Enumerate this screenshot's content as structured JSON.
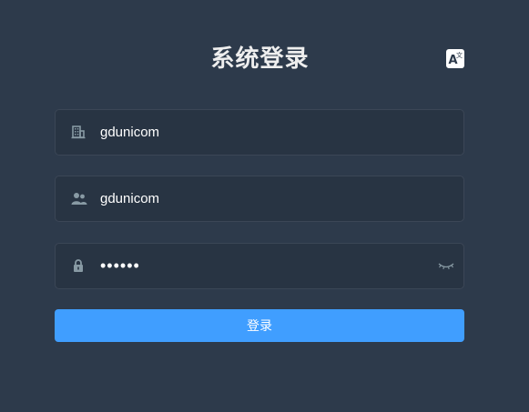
{
  "title": "系统登录",
  "lang_switch": {
    "icon": "translate-icon",
    "label": "A文"
  },
  "fields": {
    "tenant": {
      "icon": "building-icon",
      "value": "gdunicom"
    },
    "username": {
      "icon": "user-group-icon",
      "value": "gdunicom"
    },
    "password": {
      "icon": "lock-icon",
      "value": "123456",
      "toggle_icon": "eye-closed-icon"
    }
  },
  "login_button": {
    "label": "登录"
  },
  "colors": {
    "background": "#2d3a4b",
    "input_background": "#283443",
    "input_border": "#3b4656",
    "primary": "#409eff",
    "title": "#eeeeee",
    "icon": "#889aa4"
  }
}
